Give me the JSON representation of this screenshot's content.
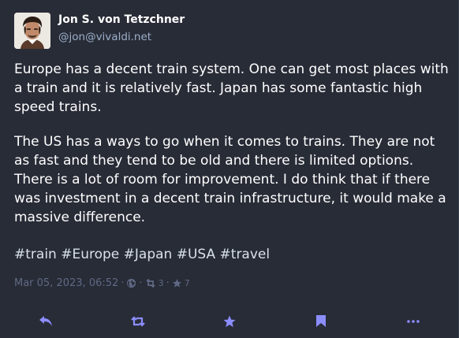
{
  "status": {
    "author": {
      "display_name": "Jon S. von Tetzchner",
      "handle": "@jon@vivaldi.net",
      "avatar_icon": "avatar-photo"
    },
    "paragraphs": [
      "Europe has a decent train system. One can get most places with a train and it is relatively fast. Japan has some fantastic high speed trains.",
      "The US has a ways to go when it comes to trains. They are not as fast and they tend to be old and there is limited options. There is a lot of room for improvement. I do think that if there was investment in a decent train infrastructure, it would make a massive difference."
    ],
    "hashtags": "#train #Europe #Japan #USA #travel",
    "meta": {
      "timestamp": "Mar 05, 2023, 06:52",
      "separator": "·",
      "visibility_icon": "globe-icon",
      "boost_count": "3",
      "favourite_count": "7"
    }
  },
  "actions": [
    {
      "name": "reply",
      "icon": "reply-icon"
    },
    {
      "name": "boost",
      "icon": "boost-icon"
    },
    {
      "name": "favourite",
      "icon": "star-icon"
    },
    {
      "name": "bookmark",
      "icon": "bookmark-icon"
    },
    {
      "name": "more",
      "icon": "ellipsis-icon"
    }
  ],
  "colors": {
    "background": "#282c37",
    "text": "#ffffff",
    "secondary": "#9baec8",
    "muted": "#606984",
    "action_icon": "#8c8dff"
  }
}
